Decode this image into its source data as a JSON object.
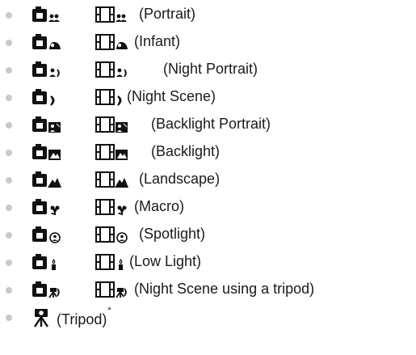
{
  "scenes": [
    {
      "icon": "portrait-scene-icon",
      "label": "(Portrait)"
    },
    {
      "icon": "infant-scene-icon",
      "label": "(Infant)"
    },
    {
      "icon": "night-portrait-scene-icon",
      "label": "(Night Portrait)"
    },
    {
      "icon": "night-scene-icon",
      "label": "(Night Scene)"
    },
    {
      "icon": "backlight-portrait-scene-icon",
      "label": "(Backlight Portrait)"
    },
    {
      "icon": "backlight-scene-icon",
      "label": "(Backlight)"
    },
    {
      "icon": "landscape-scene-icon",
      "label": "(Landscape)"
    },
    {
      "icon": "macro-scene-icon",
      "label": "(Macro)"
    },
    {
      "icon": "spotlight-scene-icon",
      "label": "(Spotlight)"
    },
    {
      "icon": "low-light-scene-icon",
      "label": "(Low Light)"
    },
    {
      "icon": "night-scene-tripod-icon",
      "label": "(Night Scene using a tripod)"
    }
  ],
  "tripod": {
    "icon": "tripod-icon",
    "label": "(Tripod)",
    "footnote_mark": "*"
  },
  "colors": {
    "icon": "#111111",
    "bullet": "#c9c9c9",
    "text": "#1a1a1a"
  }
}
